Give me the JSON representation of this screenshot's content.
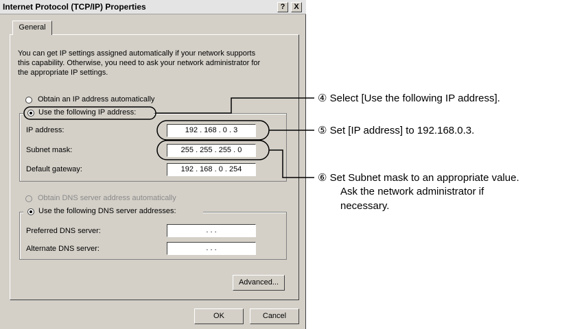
{
  "dialog": {
    "title": "Internet Protocol (TCP/IP) Properties",
    "help_btn": "?",
    "close_btn": "X",
    "tab": "General",
    "intro": [
      "You can get IP settings assigned automatically if your network supports",
      "this capability. Otherwise, you need to ask your network administrator for",
      "the appropriate IP settings."
    ],
    "ip": {
      "auto_label": "Obtain an IP address automatically",
      "manual_label": "Use the following IP address:",
      "ip_label": "IP address:",
      "ip_value": "192 . 168 . 0 . 3",
      "mask_label": "Subnet mask:",
      "mask_value": "255 . 255 . 255 . 0",
      "gateway_label": "Default gateway:",
      "gateway_value": "192 . 168 . 0 . 254"
    },
    "dns": {
      "auto_label": "Obtain DNS server address automatically",
      "manual_label": "Use the following DNS server addresses:",
      "preferred_label": "Preferred DNS server:",
      "preferred_value": ".     .     .",
      "alternate_label": "Alternate DNS server:",
      "alternate_value": ".     .     ."
    },
    "advanced_btn": "Advanced...",
    "ok_btn": "OK",
    "cancel_btn": "Cancel"
  },
  "annotations": {
    "step4": "④ Select [Use the following IP address].",
    "step5": "⑤ Set [IP address] to 192.168.0.3.",
    "step6_line1": "⑥ Set Subnet mask to an appropriate value.",
    "step6_line2": "Ask  the  network  administrator  if",
    "step6_line3": "necessary."
  }
}
